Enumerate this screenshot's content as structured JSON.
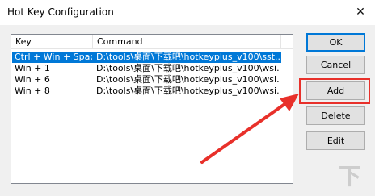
{
  "window": {
    "title": "Hot Key Configuration"
  },
  "list": {
    "columns": {
      "key": "Key",
      "command": "Command"
    },
    "rows": [
      {
        "key": "Ctrl + Win + Space",
        "command": "D:\\tools\\桌面\\下载吧\\hotkeyplus_v100\\sst...",
        "selected": true
      },
      {
        "key": "Win + 1",
        "command": "D:\\tools\\桌面\\下载吧\\hotkeyplus_v100\\wsi..."
      },
      {
        "key": "Win + 6",
        "command": "D:\\tools\\桌面\\下载吧\\hotkeyplus_v100\\wsi..."
      },
      {
        "key": "Win + 8",
        "command": "D:\\tools\\桌面\\下载吧\\hotkeyplus_v100\\wsi..."
      }
    ]
  },
  "buttons": {
    "ok": "OK",
    "cancel": "Cancel",
    "add": "Add",
    "delete": "Delete",
    "edit": "Edit"
  },
  "close_glyph": "✕",
  "watermark": "下",
  "colors": {
    "selection": "#0078d7",
    "annotation": "#e8302a"
  }
}
